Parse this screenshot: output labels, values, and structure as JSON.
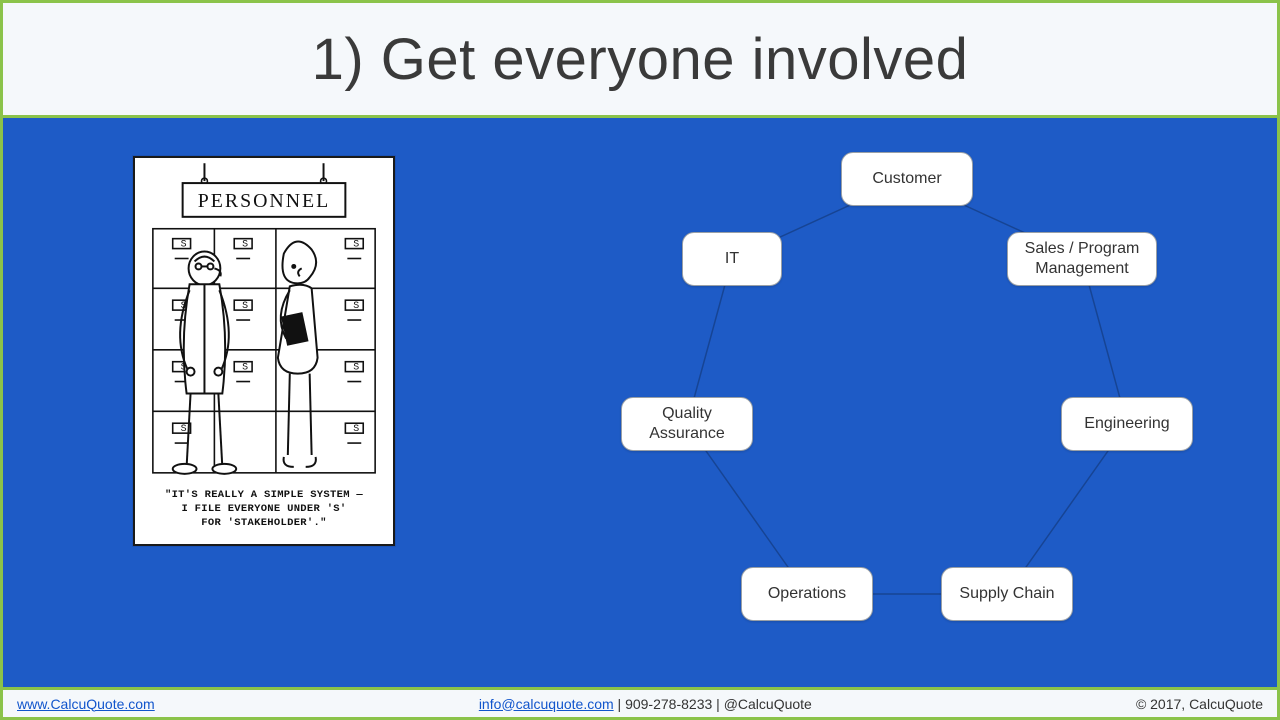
{
  "title": "1) Get everyone involved",
  "cartoon": {
    "sign": "PERSONNEL",
    "caption_line1": "\"IT'S REALLY A SIMPLE SYSTEM —",
    "caption_line2": "I FILE EVERYONE UNDER 'S'",
    "caption_line3": "FOR 'STAKEHOLDER'.\""
  },
  "ring_nodes": [
    {
      "id": "customer",
      "label": "Customer"
    },
    {
      "id": "sales",
      "label": "Sales / Program Management"
    },
    {
      "id": "engineering",
      "label": "Engineering"
    },
    {
      "id": "supply",
      "label": "Supply Chain"
    },
    {
      "id": "operations",
      "label": "Operations"
    },
    {
      "id": "qa",
      "label": "Quality Assurance"
    },
    {
      "id": "it",
      "label": "IT"
    }
  ],
  "footer": {
    "website": "www.CalcuQuote.com",
    "email": "info@calcuquote.com",
    "phone": "909-278-8233",
    "twitter": "@CalcuQuote",
    "copyright": "© 2017, CalcuQuote"
  }
}
